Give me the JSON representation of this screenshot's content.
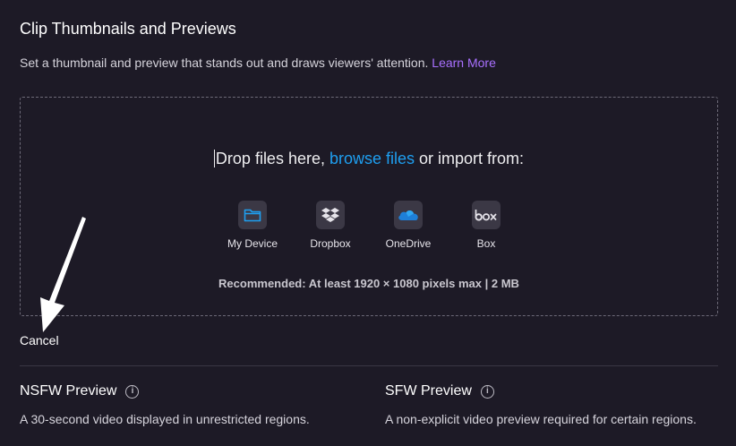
{
  "header": {
    "title": "Clip Thumbnails and Previews",
    "subtitle": "Set a thumbnail and preview that stands out and draws viewers' attention.",
    "learn_more": "Learn More"
  },
  "dropzone": {
    "text_before": "Drop files here, ",
    "browse_link": "browse files",
    "text_after": " or import from:",
    "sources": [
      {
        "label": "My Device",
        "icon": "folder-icon",
        "color": "#1e9ff0"
      },
      {
        "label": "Dropbox",
        "icon": "dropbox-icon",
        "color": "#e6e4ea"
      },
      {
        "label": "OneDrive",
        "icon": "onedrive-icon",
        "color": "#1e7fd8"
      },
      {
        "label": "Box",
        "icon": "box-logo-icon",
        "color": "#e6e4ea"
      }
    ],
    "recommendation": "Recommended: At least 1920 × 1080 pixels max | 2 MB"
  },
  "actions": {
    "cancel": "Cancel"
  },
  "previews": {
    "nsfw": {
      "title": "NSFW Preview",
      "description": "A 30-second video displayed in unrestricted regions."
    },
    "sfw": {
      "title": "SFW Preview",
      "description": "A non-explicit video preview required for certain regions."
    }
  },
  "colors": {
    "background": "#1d1a26",
    "accent_purple": "#a970ff",
    "link_blue": "#1e9ff0"
  }
}
